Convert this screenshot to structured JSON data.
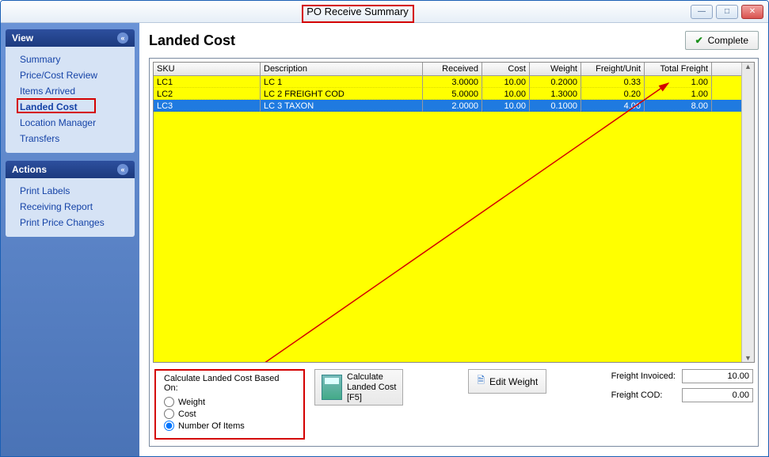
{
  "window": {
    "title": "PO Receive Summary"
  },
  "winbuttons": {
    "min": "—",
    "max": "□",
    "close": "✕"
  },
  "sidebar": {
    "view": {
      "title": "View",
      "items": [
        "Summary",
        "Price/Cost Review",
        "Items Arrived",
        "Landed Cost",
        "Location Manager",
        "Transfers"
      ]
    },
    "actions": {
      "title": "Actions",
      "items": [
        "Print Labels",
        "Receiving Report",
        "Print Price Changes"
      ]
    }
  },
  "page": {
    "title": "Landed Cost",
    "complete": "Complete"
  },
  "grid": {
    "headers": {
      "sku": "SKU",
      "desc": "Description",
      "recv": "Received",
      "cost": "Cost",
      "wt": "Weight",
      "fu": "Freight/Unit",
      "tf": "Total Freight"
    },
    "rows": [
      {
        "sku": "LC1",
        "desc": "LC 1",
        "recv": "3.0000",
        "cost": "10.00",
        "wt": "0.2000",
        "fu": "0.33",
        "tf": "1.00",
        "selected": false
      },
      {
        "sku": "LC2",
        "desc": "LC 2 FREIGHT COD",
        "recv": "5.0000",
        "cost": "10.00",
        "wt": "1.3000",
        "fu": "0.20",
        "tf": "1.00",
        "selected": false
      },
      {
        "sku": "LC3",
        "desc": "LC 3 TAXON",
        "recv": "2.0000",
        "cost": "10.00",
        "wt": "0.1000",
        "fu": "4.00",
        "tf": "8.00",
        "selected": true
      }
    ]
  },
  "calc": {
    "title": "Calculate Landed Cost Based On:",
    "options": {
      "weight": "Weight",
      "cost": "Cost",
      "items": "Number Of Items"
    },
    "selected": "items",
    "button_line1": "Calculate",
    "button_line2": "Landed Cost",
    "button_line3": "[F5]"
  },
  "edit_weight": "Edit Weight",
  "freight": {
    "invoiced_label": "Freight Invoiced:",
    "invoiced_value": "10.00",
    "cod_label": "Freight COD:",
    "cod_value": "0.00"
  }
}
